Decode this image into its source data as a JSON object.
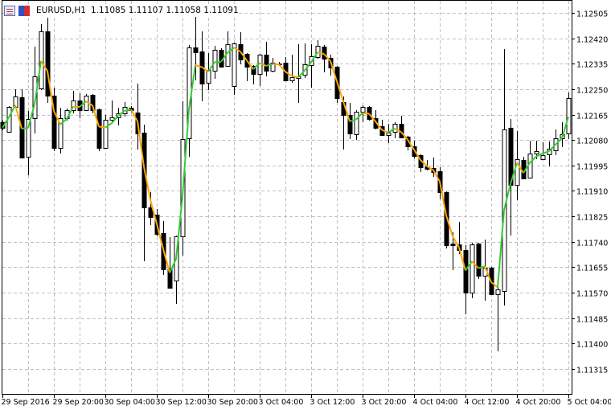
{
  "header": {
    "symbol": "EURUSD,H1",
    "ohlc_text": "1.11085 1.11107 1.11058 1.11091",
    "icons": [
      "data-window-icon",
      "save-template-icon"
    ]
  },
  "colors": {
    "background": "#ffffff",
    "grid": "#c0c0c0",
    "bull_body": "#ffffff",
    "bear_body": "#000000",
    "ma_up": "#32cd32",
    "ma_down": "#ffa500"
  },
  "chart_data": {
    "type": "candlestick",
    "title": "EURUSD,H1",
    "price_ticks": [
      "1.12505",
      "1.12420",
      "1.12335",
      "1.12250",
      "1.12165",
      "1.12080",
      "1.11995",
      "1.11910",
      "1.11825",
      "1.11740",
      "1.11655",
      "1.11570",
      "1.11485",
      "1.11400",
      "1.11315"
    ],
    "ylim": [
      1.1126,
      1.12548
    ],
    "time_labels": [
      "29 Sep 2016",
      "29 Sep 20:00",
      "30 Sep 04:00",
      "30 Sep 12:00",
      "30 Sep 20:00",
      "3 Oct 04:00",
      "3 Oct 12:00",
      "3 Oct 20:00",
      "4 Oct 04:00",
      "4 Oct 12:00",
      "4 Oct 20:00",
      "5 Oct 04:00"
    ],
    "time_label_every_n_bars": 8,
    "grid": true,
    "ohlc": [
      [
        1.1214,
        1.12145,
        1.12113,
        1.12121
      ],
      [
        1.12108,
        1.12193,
        1.12105,
        1.12191
      ],
      [
        1.12191,
        1.1225,
        1.12188,
        1.12226
      ],
      [
        1.12223,
        1.1225,
        1.12019,
        1.12022
      ],
      [
        1.12024,
        1.12177,
        1.11962,
        1.1215
      ],
      [
        1.12153,
        1.12392,
        1.12102,
        1.12293
      ],
      [
        1.12252,
        1.12467,
        1.12247,
        1.12443
      ],
      [
        1.12443,
        1.12489,
        1.12204,
        1.12228
      ],
      [
        1.12228,
        1.12255,
        1.12043,
        1.12054
      ],
      [
        1.12054,
        1.12188,
        1.12035,
        1.12153
      ],
      [
        1.12153,
        1.12185,
        1.12145,
        1.1218
      ],
      [
        1.1218,
        1.12244,
        1.12169,
        1.12212
      ],
      [
        1.12212,
        1.12236,
        1.12153,
        1.1218
      ],
      [
        1.1218,
        1.12234,
        1.12177,
        1.12228
      ],
      [
        1.12231,
        1.12234,
        1.12169,
        1.1218
      ],
      [
        1.12183,
        1.12185,
        1.12043,
        1.12054
      ],
      [
        1.12054,
        1.12164,
        1.12051,
        1.12148
      ],
      [
        1.12148,
        1.12212,
        1.12142,
        1.12156
      ],
      [
        1.12156,
        1.12188,
        1.12129,
        1.12169
      ],
      [
        1.12169,
        1.12207,
        1.12159,
        1.12191
      ],
      [
        1.12188,
        1.12193,
        1.12172,
        1.1218
      ],
      [
        1.12172,
        1.12269,
        1.12048,
        1.12102
      ],
      [
        1.12105,
        1.12132,
        1.11675,
        1.11855
      ],
      [
        1.11855,
        1.11906,
        1.11796,
        1.11823
      ],
      [
        1.11831,
        1.1185,
        1.11758,
        1.11766
      ],
      [
        1.11769,
        1.11809,
        1.11629,
        1.11648
      ],
      [
        1.11651,
        1.11756,
        1.11586,
        1.11586
      ],
      [
        1.11611,
        1.11761,
        1.11533,
        1.11758
      ],
      [
        1.11758,
        1.1221,
        1.11694,
        1.12083
      ],
      [
        1.12086,
        1.12398,
        1.12024,
        1.1239
      ],
      [
        1.1239,
        1.12508,
        1.12279,
        1.12373
      ],
      [
        1.12376,
        1.12443,
        1.1221,
        1.12269
      ],
      [
        1.12271,
        1.12371,
        1.12247,
        1.12314
      ],
      [
        1.12312,
        1.12395,
        1.12285,
        1.12381
      ],
      [
        1.12381,
        1.12387,
        1.12322,
        1.12325
      ],
      [
        1.12328,
        1.12443,
        1.12325,
        1.124
      ],
      [
        1.12261,
        1.12406,
        1.12231,
        1.12403
      ],
      [
        1.124,
        1.12441,
        1.12333,
        1.12349
      ],
      [
        1.12368,
        1.12371,
        1.12277,
        1.12325
      ],
      [
        1.12328,
        1.1233,
        1.12266,
        1.12301
      ],
      [
        1.12301,
        1.12368,
        1.12261,
        1.12365
      ],
      [
        1.12365,
        1.12408,
        1.12293,
        1.12312
      ],
      [
        1.12312,
        1.12355,
        1.12306,
        1.12339
      ],
      [
        1.12336,
        1.12341,
        1.12328,
        1.12336
      ],
      [
        1.12339,
        1.12357,
        1.12277,
        1.12279
      ],
      [
        1.12279,
        1.12365,
        1.12271,
        1.1229
      ],
      [
        1.12288,
        1.124,
        1.12204,
        1.12293
      ],
      [
        1.12298,
        1.12403,
        1.12288,
        1.12333
      ],
      [
        1.1233,
        1.124,
        1.12255,
        1.1236
      ],
      [
        1.12357,
        1.12414,
        1.12352,
        1.12395
      ],
      [
        1.12392,
        1.12398,
        1.12306,
        1.12352
      ],
      [
        1.12355,
        1.12365,
        1.12296,
        1.12322
      ],
      [
        1.12325,
        1.12328,
        1.12204,
        1.1222
      ],
      [
        1.12207,
        1.12226,
        1.12048,
        1.12164
      ],
      [
        1.12164,
        1.12204,
        1.12083,
        1.12102
      ],
      [
        1.12099,
        1.1218,
        1.12081,
        1.12175
      ],
      [
        1.12175,
        1.12196,
        1.1214,
        1.12191
      ],
      [
        1.12191,
        1.12193,
        1.12145,
        1.1215
      ],
      [
        1.12153,
        1.1218,
        1.12116,
        1.12121
      ],
      [
        1.12126,
        1.12148,
        1.12094,
        1.12097
      ],
      [
        1.12097,
        1.12134,
        1.1207,
        1.12105
      ],
      [
        1.12108,
        1.1214,
        1.12086,
        1.12134
      ],
      [
        1.12134,
        1.12161,
        1.12086,
        1.12089
      ],
      [
        1.12091,
        1.12094,
        1.12046,
        1.12059
      ],
      [
        1.12059,
        1.12078,
        1.12019,
        1.12027
      ],
      [
        1.1203,
        1.12032,
        1.11973,
        1.11989
      ],
      [
        1.11992,
        1.12013,
        1.11979,
        1.11984
      ],
      [
        1.11987,
        1.12022,
        1.11957,
        1.11973
      ],
      [
        1.11976,
        1.11989,
        1.11882,
        1.11906
      ],
      [
        1.11906,
        1.11909,
        1.11718,
        1.11729
      ],
      [
        1.11734,
        1.11772,
        1.11645,
        1.11729
      ],
      [
        1.11731,
        1.11807,
        1.11699,
        1.11713
      ],
      [
        1.11713,
        1.11729,
        1.11498,
        1.1157
      ],
      [
        1.1157,
        1.11737,
        1.11551,
        1.11731
      ],
      [
        1.11734,
        1.11737,
        1.11616,
        1.11627
      ],
      [
        1.11627,
        1.11748,
        1.11543,
        1.11654
      ],
      [
        1.11654,
        1.11656,
        1.11562,
        1.11565
      ],
      [
        1.11565,
        1.11603,
        1.11374,
        1.11581
      ],
      [
        1.11576,
        1.12384,
        1.11527,
        1.12116
      ],
      [
        1.12121,
        1.1215,
        1.11761,
        1.1193
      ],
      [
        1.1193,
        1.1211,
        1.11879,
        1.12016
      ],
      [
        1.12013,
        1.12024,
        1.11949,
        1.11952
      ],
      [
        1.11954,
        1.12078,
        1.11952,
        1.12035
      ],
      [
        1.12035,
        1.12078,
        1.12016,
        1.12043
      ],
      [
        1.12016,
        1.12073,
        1.12013,
        1.1203
      ],
      [
        1.12032,
        1.12075,
        1.11992,
        1.12051
      ],
      [
        1.12046,
        1.12116,
        1.1203,
        1.12086
      ],
      [
        1.12086,
        1.1214,
        1.12057,
        1.12099
      ],
      [
        1.12102,
        1.12239,
        1.12083,
        1.1222
      ]
    ]
  }
}
